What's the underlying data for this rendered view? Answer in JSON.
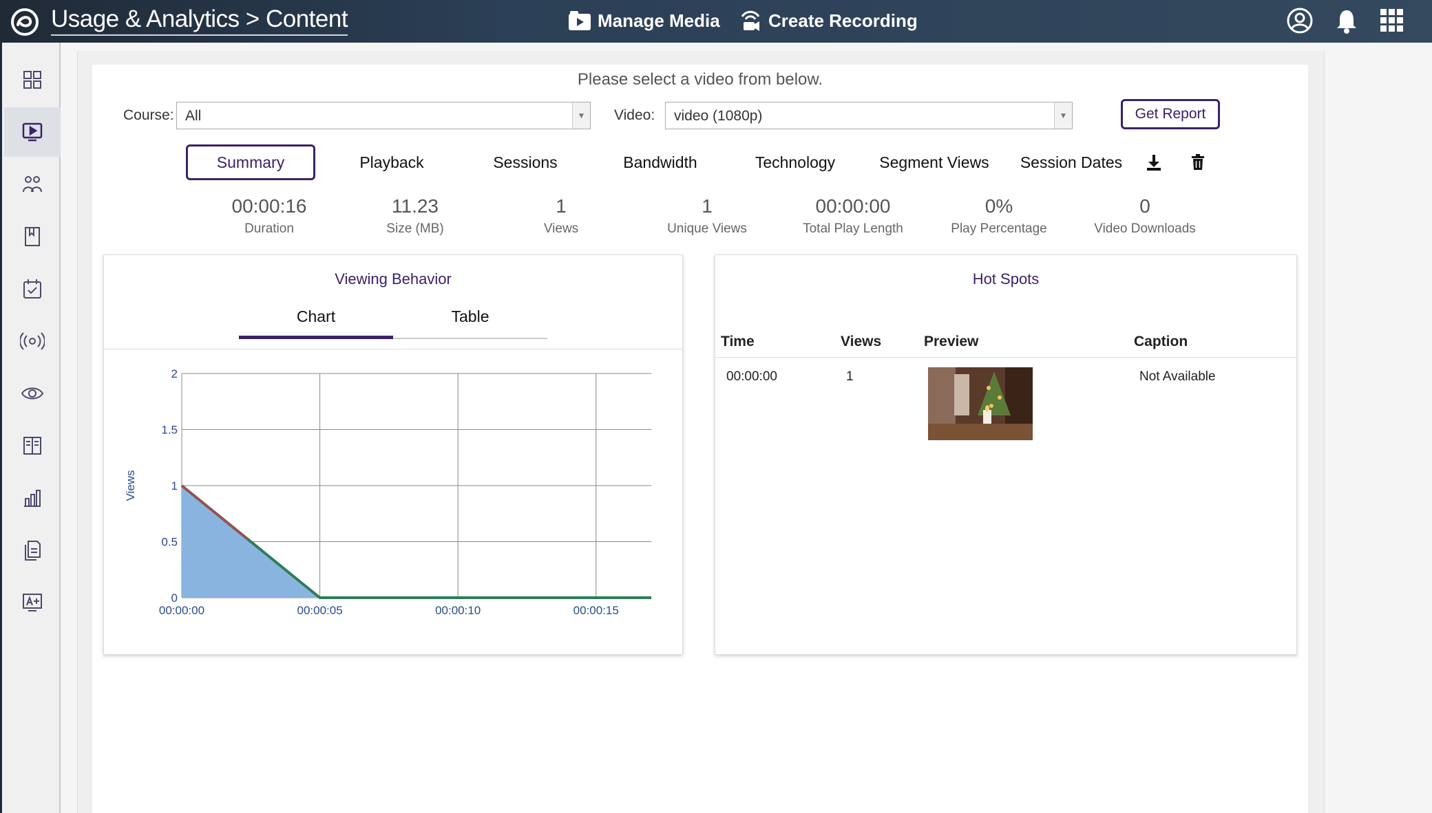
{
  "header": {
    "title": "Usage & Analytics > Content",
    "manage_media": "Manage Media",
    "create_recording": "Create Recording"
  },
  "sidebar": {
    "items": [
      {
        "icon": "dashboard-grid-icon"
      },
      {
        "icon": "video-play-icon",
        "active": true
      },
      {
        "icon": "users-group-icon"
      },
      {
        "icon": "bookmark-book-icon"
      },
      {
        "icon": "calendar-check-icon"
      },
      {
        "icon": "broadcast-icon"
      },
      {
        "icon": "eye-icon"
      },
      {
        "icon": "open-book-icon"
      },
      {
        "icon": "bar-chart-icon"
      },
      {
        "icon": "documents-icon"
      },
      {
        "icon": "grade-a-plus-icon"
      }
    ]
  },
  "filters": {
    "prompt": "Please select a video from below.",
    "course_label": "Course:",
    "course_value": "All",
    "video_label": "Video:",
    "video_value": "video (1080p)",
    "get_report": "Get Report"
  },
  "tabs": [
    "Summary",
    "Playback",
    "Sessions",
    "Bandwidth",
    "Technology",
    "Segment Views",
    "Session Dates"
  ],
  "stats": [
    {
      "value": "00:00:16",
      "label": "Duration"
    },
    {
      "value": "11.23",
      "label": "Size (MB)"
    },
    {
      "value": "1",
      "label": "Views"
    },
    {
      "value": "1",
      "label": "Unique Views"
    },
    {
      "value": "00:00:00",
      "label": "Total Play Length"
    },
    {
      "value": "0%",
      "label": "Play Percentage"
    },
    {
      "value": "0",
      "label": "Video Downloads"
    }
  ],
  "viewing": {
    "title": "Viewing Behavior",
    "tab_chart": "Chart",
    "tab_table": "Table"
  },
  "chart_data": {
    "type": "area",
    "x": [
      "00:00:00",
      "00:00:05",
      "00:00:10",
      "00:00:15",
      "00:00:17"
    ],
    "xticks": [
      "00:00:00",
      "00:00:05",
      "00:00:10",
      "00:00:15"
    ],
    "x_seconds": [
      0,
      5,
      10,
      15,
      17
    ],
    "series": [
      {
        "values": [
          1,
          0,
          0,
          0,
          0
        ],
        "color": "#5b9bd5"
      }
    ],
    "ylabel": "Views",
    "ylim": [
      0,
      2
    ],
    "yticks": [
      "0",
      "0.5",
      "1",
      "1.5",
      "2"
    ],
    "ytick_values": [
      0,
      0.5,
      1,
      1.5,
      2
    ],
    "grid": true,
    "colors": {
      "fill": "#8ab4e0",
      "line_top": "#b0464b",
      "line_bottom": "#2e7d5a",
      "axis_text": "#2a4a8a"
    }
  },
  "hotspots": {
    "title": "Hot Spots",
    "headers": {
      "time": "Time",
      "views": "Views",
      "preview": "Preview",
      "caption": "Caption"
    },
    "rows": [
      {
        "time": "00:00:00",
        "views": "1",
        "caption": "Not Available"
      }
    ]
  }
}
